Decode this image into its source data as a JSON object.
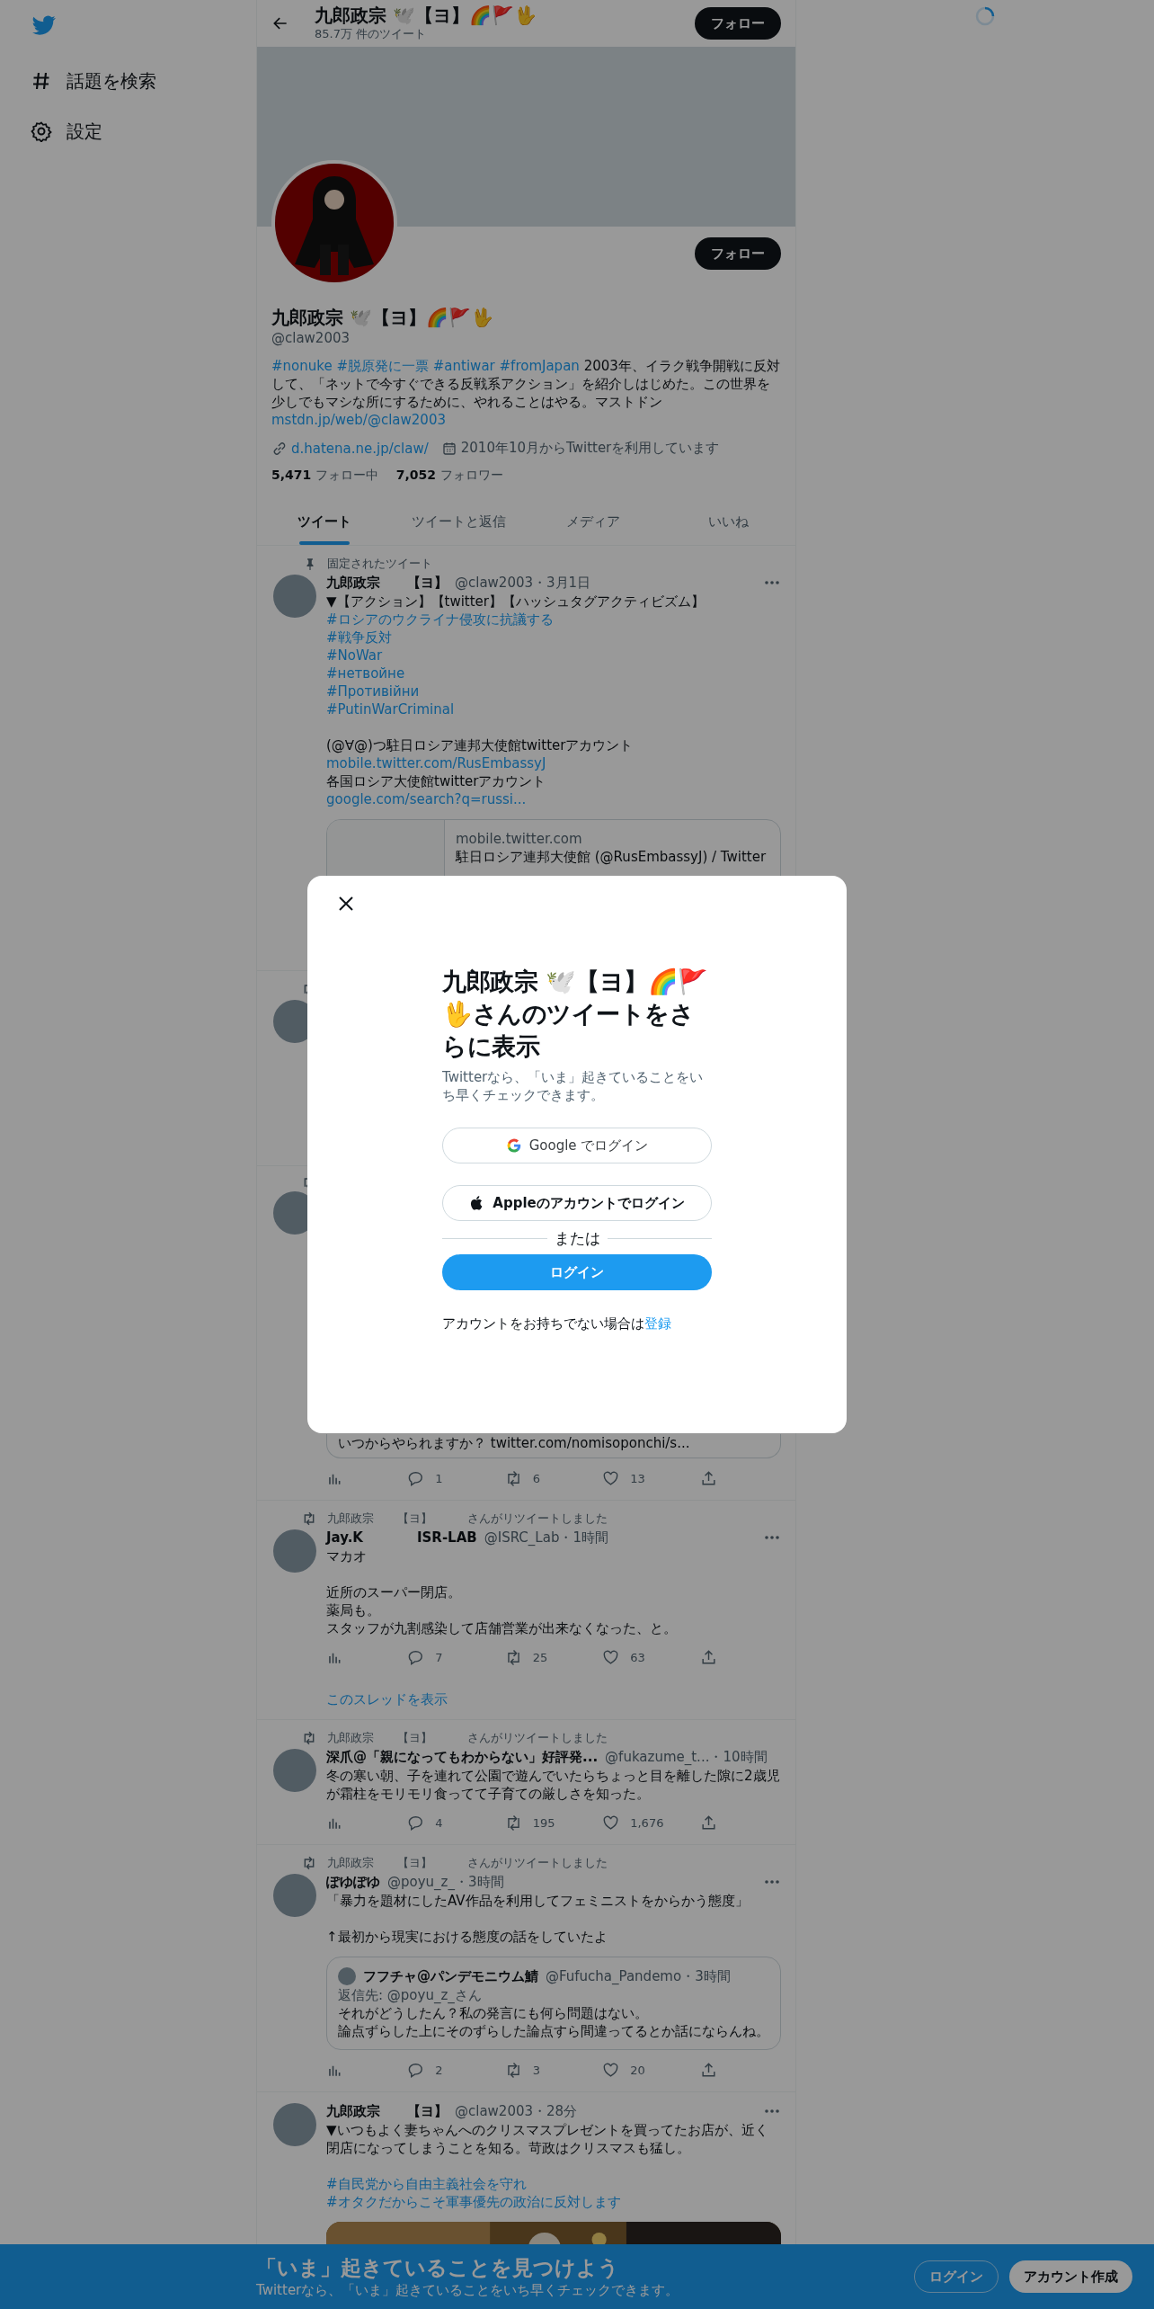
{
  "sidebar": {
    "items": [
      {
        "label": "話題を検索"
      },
      {
        "label": "設定"
      }
    ]
  },
  "header": {
    "title": "九郎政宗 🕊️【ヨ】🌈🚩🖖",
    "subtitle": "85.7万 件のツイート",
    "follow": "フォロー"
  },
  "profile": {
    "follow": "フォロー",
    "name": "九郎政宗 🕊️【ヨ】🌈🚩🖖",
    "handle": "@claw2003",
    "bio": [
      {
        "kind": "link",
        "text": "#nonuke"
      },
      {
        "kind": "link",
        "text": "#脱原発に一票"
      },
      {
        "kind": "link",
        "text": "#antiwar"
      },
      {
        "kind": "link",
        "text": "#fromJapan"
      },
      {
        "kind": "text",
        "text": "2003年、イラク戦争開戦に反対して、「ネットで今すぐできる反戦系アクション」を紹介しはじめた。この世界を少しでもマシな所にするために、やれることはやる。マストドン"
      },
      {
        "kind": "link",
        "text": "mstdn.jp/web/@claw2003"
      }
    ],
    "link": "d.hatena.ne.jp/claw/",
    "joined": "2010年10月からTwitterを利用しています",
    "following_count": "5,471",
    "following_label": "フォロー中",
    "followers_count": "7,052",
    "followers_label": "フォロワー"
  },
  "tabs": [
    {
      "label": "ツイート",
      "selected": true
    },
    {
      "label": "ツイートと返信",
      "selected": false
    },
    {
      "label": "メディア",
      "selected": false
    },
    {
      "label": "いいね",
      "selected": false
    }
  ],
  "tweets": [
    {
      "kind": "full",
      "pinned_label": "固定されたツイート",
      "name": "九郎政宗　　【ヨ】",
      "handle": "@claw2003",
      "time": "・3月1日",
      "lines": [
        {
          "kind": "text",
          "text": "▼【アクション】【twitter】【ハッシュタグアクティビズム】"
        },
        {
          "kind": "link",
          "text": "#ロシアのウクライナ侵攻に抗議する"
        },
        {
          "kind": "link",
          "text": "#戦争反対"
        },
        {
          "kind": "link",
          "text": "#NoWar"
        },
        {
          "kind": "link",
          "text": "#нетвойне"
        },
        {
          "kind": "link",
          "text": "#Противійни"
        },
        {
          "kind": "link",
          "text": "#PutinWarCriminal"
        },
        {
          "kind": "gap"
        },
        {
          "kind": "text",
          "text": "(@∀@)つ駐日ロシア連邦大使館twitterアカウント"
        },
        {
          "kind": "link",
          "text": "mobile.twitter.com/RusEmbassyJ"
        },
        {
          "kind": "text",
          "text": "各国ロシア大使館twitterアカウント"
        },
        {
          "kind": "link",
          "text": "google.com/search?q=russi..."
        }
      ],
      "card": {
        "domain": "mobile.twitter.com",
        "title": "駐日ロシア連邦大使館 (@RusEmbassyJ) / Twitter"
      }
    },
    {
      "kind": "covered",
      "retweeted": true
    },
    {
      "kind": "covered",
      "retweeted": true,
      "quote_tail": "いつからやられますか？ twitter.com/nomisoponchi/s...",
      "metrics": {
        "replies": "1",
        "retweets": "6",
        "likes": "13"
      }
    },
    {
      "kind": "full",
      "retweeted_by": "九郎政宗　　【ヨ】　　　さんがリツイートしました",
      "name": "Jay.K　　　　ISR-LAB",
      "handle": "@ISRC_Lab",
      "time": "・1時間",
      "lines": [
        {
          "kind": "text",
          "text": "マカオ"
        },
        {
          "kind": "gap"
        },
        {
          "kind": "text",
          "text": "近所のスーパー閉店。"
        },
        {
          "kind": "text",
          "text": "薬局も。"
        },
        {
          "kind": "text",
          "text": "スタッフが九割感染して店舗営業が出来なくなった、と。"
        }
      ],
      "metrics": {
        "replies": "7",
        "retweets": "25",
        "likes": "63"
      },
      "thread_link": "このスレッドを表示"
    },
    {
      "kind": "full",
      "retweeted_by": "九郎政宗　　【ヨ】　　　さんがリツイートしました",
      "name": "深爪@「親になってもわからない」好評発...",
      "handle": "@fukazume_t...",
      "time": "・10時間",
      "lines": [
        {
          "kind": "text",
          "text": "冬の寒い朝、子を連れて公園で遊んでいたらちょっと目を離した隙に2歳児が霜柱をモリモリ食ってて子育ての厳しさを知った。"
        }
      ],
      "metrics": {
        "replies": "4",
        "retweets": "195",
        "likes": "1,676"
      }
    },
    {
      "kind": "full",
      "retweeted_by": "九郎政宗　　【ヨ】　　　さんがリツイートしました",
      "name": "ぽゆぽゆ",
      "handle": "@poyu_z_",
      "time": "・3時間",
      "lines": [
        {
          "kind": "text",
          "text": "「暴力を題材にしたAV作品を利用してフェミニストをからかう態度」"
        },
        {
          "kind": "gap"
        },
        {
          "kind": "text",
          "text": "↑最初から現実における態度の話をしていたよ"
        }
      ],
      "quote": {
        "name": "フフチャ@パンデモニウム鯖",
        "handle": "@Fufucha_Pandemo",
        "time": "・3時間",
        "reply_to": "返信先: @poyu_z_さん",
        "lines": [
          "それがどうしたん？私の発言にも何ら問題はない。",
          "論点ずらした上にそのずらした論点すら間違ってるとか話にならんね。"
        ]
      },
      "metrics": {
        "replies": "2",
        "retweets": "3",
        "likes": "20"
      }
    },
    {
      "kind": "full",
      "name": "九郎政宗　　【ヨ】",
      "handle": "@claw2003",
      "time": "・28分",
      "lines": [
        {
          "kind": "text",
          "text": "▼いつもよく妻ちゃんへのクリスマスプレゼントを買ってたお店が、近く閉店になってしまうことを知る。苛政はクリスマスも猛し。"
        },
        {
          "kind": "gap"
        },
        {
          "kind": "link",
          "text": "#自民党から自由主義社会を守れ"
        },
        {
          "kind": "link",
          "text": "#オタクだからこそ軍事優先の政治に反対します"
        }
      ],
      "image": {
        "kind": "picture"
      }
    }
  ],
  "modal": {
    "title": "九郎政宗 🕊️【ヨ】🌈🚩🖖さんのツイートをさらに表示",
    "subtitle": "Twitterなら、「いま」起きていることをいち早くチェックできます。",
    "google": "Google でログイン",
    "apple": "Appleのアカウントでログイン",
    "divider": "または",
    "login": "ログイン",
    "signup_prompt": "アカウントをお持ちでない場合は",
    "signup_link": "登録"
  },
  "banner": {
    "title": "「いま」起きていることを見つけよう",
    "subtitle": "Twitterなら、「いま」起きていることをいち早くチェックできます。",
    "login": "ログイン",
    "signup": "アカウント作成"
  }
}
